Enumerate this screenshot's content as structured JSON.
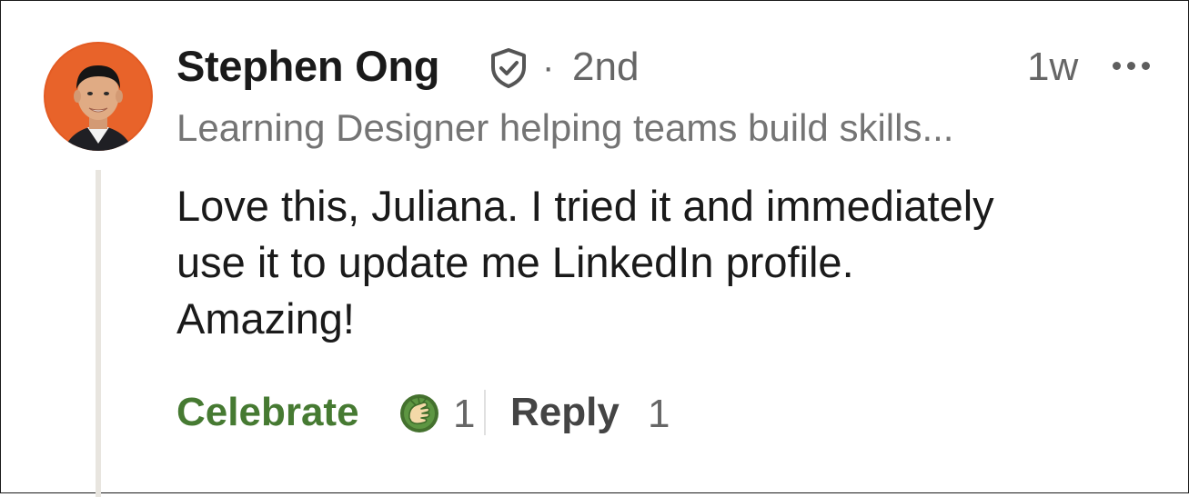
{
  "comment": {
    "author": {
      "name": "Stephen Ong",
      "connection_degree": "2nd",
      "separator": "·",
      "headline": "Learning Designer helping teams build skills..."
    },
    "timestamp": "1w",
    "body_lines": [
      "Love this, Juliana. I tried it and immediately",
      "use it to update me LinkedIn profile.",
      "Amazing!"
    ],
    "actions": {
      "celebrate_label": "Celebrate",
      "reaction_count": "1",
      "reply_label": "Reply",
      "reply_count": "1"
    },
    "icons": {
      "verified": "verified-shield-icon",
      "more": "more-options-icon",
      "reaction": "celebrate-hands-icon"
    }
  },
  "colors": {
    "celebrate": "#467a32",
    "avatar_background": "#e35b23",
    "thread_line": "#e8e5df",
    "secondary_text": "#666666"
  }
}
